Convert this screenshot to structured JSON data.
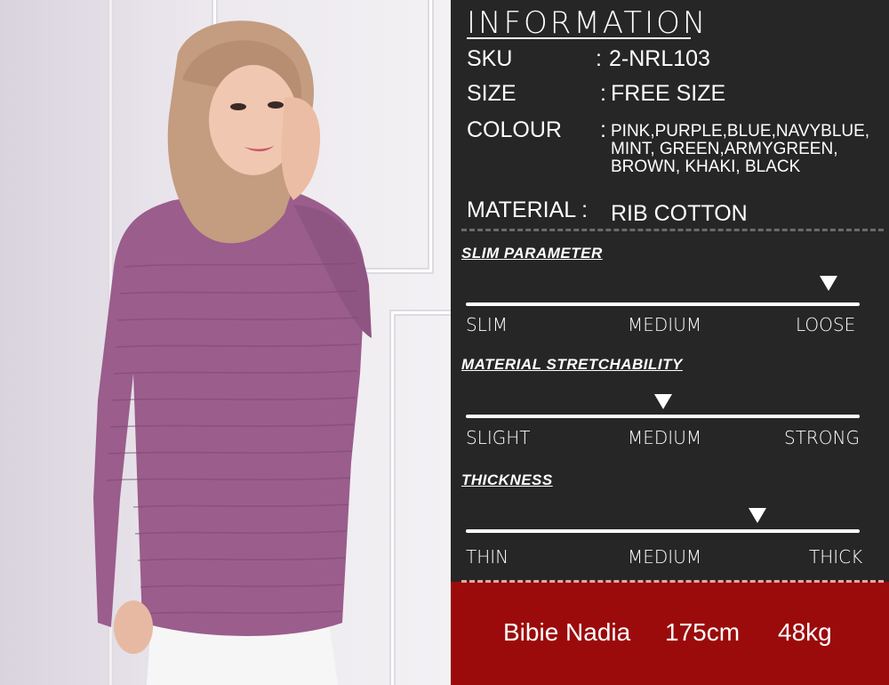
{
  "info": {
    "title": "INFORMATION",
    "sku_label": "SKU",
    "sku_sep": ":",
    "sku_value": "2-NRL103",
    "size_label": "SIZE",
    "size_sep": ":",
    "size_value": "FREE SIZE",
    "colour_label": "COLOUR",
    "colour_sep": ":",
    "colour_value": "PINK,PURPLE,BLUE,NAVYBLUE, MINT, GREEN,ARMYGREEN, BROWN, KHAKI, BLACK",
    "material_label": "MATERIAL :",
    "material_value": "RIB COTTON"
  },
  "scales": {
    "slim": {
      "title": "SLIM PARAMETER",
      "min": "SLIM",
      "mid": "MEDIUM",
      "max": "LOOSE",
      "level": 0.92
    },
    "stretch": {
      "title": "MATERIAL STRETCHABILITY",
      "min": "SLIGHT",
      "mid": "MEDIUM",
      "max": "STRONG",
      "level": 0.5
    },
    "thickness": {
      "title": "THICKNESS",
      "min": "THIN",
      "mid": "MEDIUM",
      "max": "THICK",
      "level": 0.74
    }
  },
  "model": {
    "name": "Bibie Nadia",
    "height": "175cm",
    "weight": "48kg"
  },
  "colors": {
    "panel": "#262626",
    "model_bar": "#9b0b0b",
    "top_purple": "#9a5d8c",
    "hijab": "#c49c80"
  }
}
